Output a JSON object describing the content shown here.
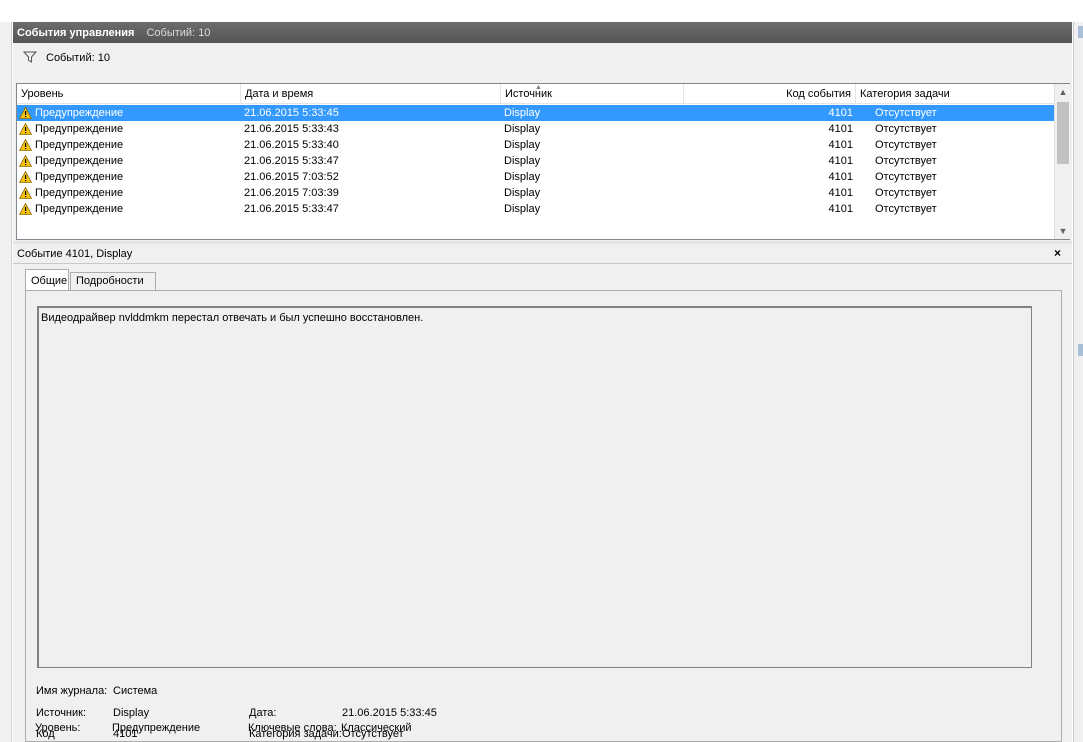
{
  "panel": {
    "title": "События управления",
    "title_count": "Событий: 10"
  },
  "filter": {
    "icon": "funnel-icon",
    "label": "Событий: 10"
  },
  "grid": {
    "columns": [
      "Уровень",
      "Дата и время",
      "Источник",
      "Код события",
      "Категория задачи"
    ],
    "sorted_column": "Источник",
    "rows": [
      {
        "level": "Предупреждение",
        "datetime": "21.06.2015 5:33:45",
        "source": "Display",
        "code": "4101",
        "category": "Отсутствует",
        "selected": true
      },
      {
        "level": "Предупреждение",
        "datetime": "21.06.2015 5:33:43",
        "source": "Display",
        "code": "4101",
        "category": "Отсутствует"
      },
      {
        "level": "Предупреждение",
        "datetime": "21.06.2015 5:33:40",
        "source": "Display",
        "code": "4101",
        "category": "Отсутствует"
      },
      {
        "level": "Предупреждение",
        "datetime": "21.06.2015 5:33:47",
        "source": "Display",
        "code": "4101",
        "category": "Отсутствует"
      },
      {
        "level": "Предупреждение",
        "datetime": "21.06.2015 7:03:52",
        "source": "Display",
        "code": "4101",
        "category": "Отсутствует"
      },
      {
        "level": "Предупреждение",
        "datetime": "21.06.2015 7:03:39",
        "source": "Display",
        "code": "4101",
        "category": "Отсутствует"
      },
      {
        "level": "Предупреждение",
        "datetime": "21.06.2015 5:33:47",
        "source": "Display",
        "code": "4101",
        "category": "Отсутствует"
      }
    ]
  },
  "detail": {
    "title": "Событие 4101, Display",
    "close_glyph": "×",
    "tabs": [
      {
        "label": "Общие",
        "active": true
      },
      {
        "label": "Подробности",
        "active": false
      }
    ],
    "description": "Видеодрайвер nvlddmkm перестал отвечать и был успешно восстановлен.",
    "props": {
      "log_name_label": "Имя журнала:",
      "log_name_value": "Система",
      "source_label": "Источник:",
      "source_value": "Display",
      "date_label": "Дата:",
      "date_value": "21.06.2015 5:33:45",
      "code_label": "Код",
      "code_value": "4101",
      "task_category_label": "Категория задачи:",
      "task_category_value": "Отсутствует",
      "level_label": "Уровень:",
      "level_value": "Предупреждение",
      "keywords_label": "Ключевые слова:",
      "keywords_value": "Классический"
    }
  },
  "colors": {
    "selection": "#3399ff",
    "title_bar": "#5f5f5f",
    "warning_fill": "#f5c211"
  }
}
